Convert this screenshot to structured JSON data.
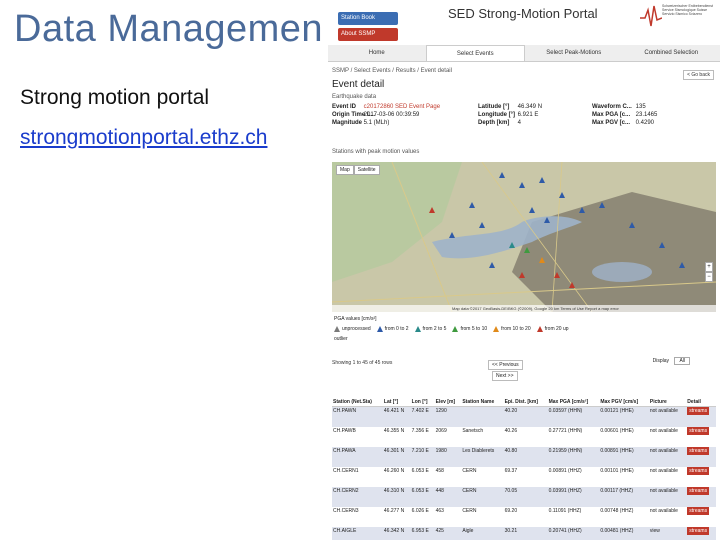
{
  "slide": {
    "title": "Data Managemen",
    "bullet1": "Strong motion portal",
    "bullet2": "strongmotionportal.ethz.ch"
  },
  "portal": {
    "station_book": "Station Book",
    "about": "About SSMP",
    "title": "SED Strong-Motion Portal",
    "logo_text": "Schweizerischer Erdbebendienst Service Sismologique Suisse Servizio Sismico Svizzero",
    "tabs": [
      "Home",
      "Select Events",
      "Select Peak-Motions",
      "Combined Selection"
    ],
    "breadcrumb": "SSMP / Select Events / Results / Event detail",
    "back_link": "< Go back",
    "event_heading": "Event detail",
    "eq_sub": "Earthquake data",
    "event_info": {
      "left": [
        {
          "label": "Event ID",
          "value": "c20172860 SED Event Page"
        },
        {
          "label": "Origin Time L...",
          "value": "2017-03-06 00:39:59"
        },
        {
          "label": "Magnitude",
          "value": "5.1 (MLh)"
        }
      ],
      "mid": [
        {
          "label": "Latitude [°]",
          "value": "46.349 N"
        },
        {
          "label": "Longitude [°]",
          "value": "6.921 E"
        },
        {
          "label": "Depth [km]",
          "value": "4"
        }
      ],
      "right": [
        {
          "label": "Waveform C...",
          "value": "135"
        },
        {
          "label": "Max PGA [c...",
          "value": "23.1465"
        },
        {
          "label": "Max PGV [c...",
          "value": "0.4290"
        }
      ]
    },
    "stations_heading": "Stations with peak motion values",
    "map_buttons": [
      "Map",
      "Satellite"
    ],
    "map_footer": "Map data ©2017 GeoBasis-DE/BKG (©2009), Google   20 km   Terms of Use   Report a map error",
    "legend": {
      "title": "PGA values [cm/s²]",
      "items": [
        {
          "label": "unprocessed",
          "color": "#7a7a7a"
        },
        {
          "label": "from 0 to 2",
          "color": "#2e5aa8"
        },
        {
          "label": "from 2 to 5",
          "color": "#2a8a8a"
        },
        {
          "label": "from 5 to 10",
          "color": "#3f9a3f"
        },
        {
          "label": "from 10 to 20",
          "color": "#e08a1a"
        },
        {
          "label": "from 20 up",
          "color": "#c0392b"
        }
      ],
      "outlier": "outlier"
    },
    "showing": "Showing 1 to 45 of 45 rows",
    "prev": "<< Previous",
    "next": "Next >>",
    "display": {
      "label": "Display",
      "value": "All"
    },
    "table": {
      "headers": [
        "Station (Net.Sta)",
        "Lat [°]",
        "Lon [°]",
        "Elev [m]",
        "Station Name",
        "Epi. Dist. [km]",
        "Max PGA [cm/s²]",
        "Max PGV [cm/s]",
        "Picture",
        "Detail"
      ],
      "rows": [
        [
          "CH.PAWN",
          "46.421 N",
          "7.402 E",
          "1290",
          "",
          "40.20",
          "0.03597 (HHN)",
          "0.00121 (HHE)",
          "not available",
          "streams"
        ],
        [
          "CH.PAWB",
          "46.355 N",
          "7.356 E",
          "2069",
          "Sanetsch",
          "40.26",
          "0.27721 (HHN)",
          "0.00601 (HHE)",
          "not available",
          "streams"
        ],
        [
          "CH.PAWA",
          "46.301 N",
          "7.210 E",
          "1980",
          "Les Diablerets",
          "40.80",
          "0.21959 (HHN)",
          "0.00891 (HHE)",
          "not available",
          "streams"
        ],
        [
          "CH.CERN1",
          "46.260 N",
          "6.053 E",
          "458",
          "CERN",
          "69.37",
          "0.00891 (HHZ)",
          "0.00101 (HHE)",
          "not available",
          "streams"
        ],
        [
          "CH.CERN2",
          "46.310 N",
          "6.053 E",
          "448",
          "CERN",
          "70.05",
          "0.03991 (HHZ)",
          "0.00117 (HHZ)",
          "not available",
          "streams"
        ],
        [
          "CH.CERN3",
          "46.277 N",
          "6.026 E",
          "463",
          "CERN",
          "69.20",
          "0.11091 (HHZ)",
          "0.00748 (HHZ)",
          "not available",
          "streams"
        ],
        [
          "CH.AIGLE",
          "46.342 N",
          "6.953 E",
          "425",
          "Aigle",
          "30.21",
          "0.20741 (HHZ)",
          "0.00481 (HHZ)",
          "view",
          "streams"
        ]
      ]
    }
  }
}
